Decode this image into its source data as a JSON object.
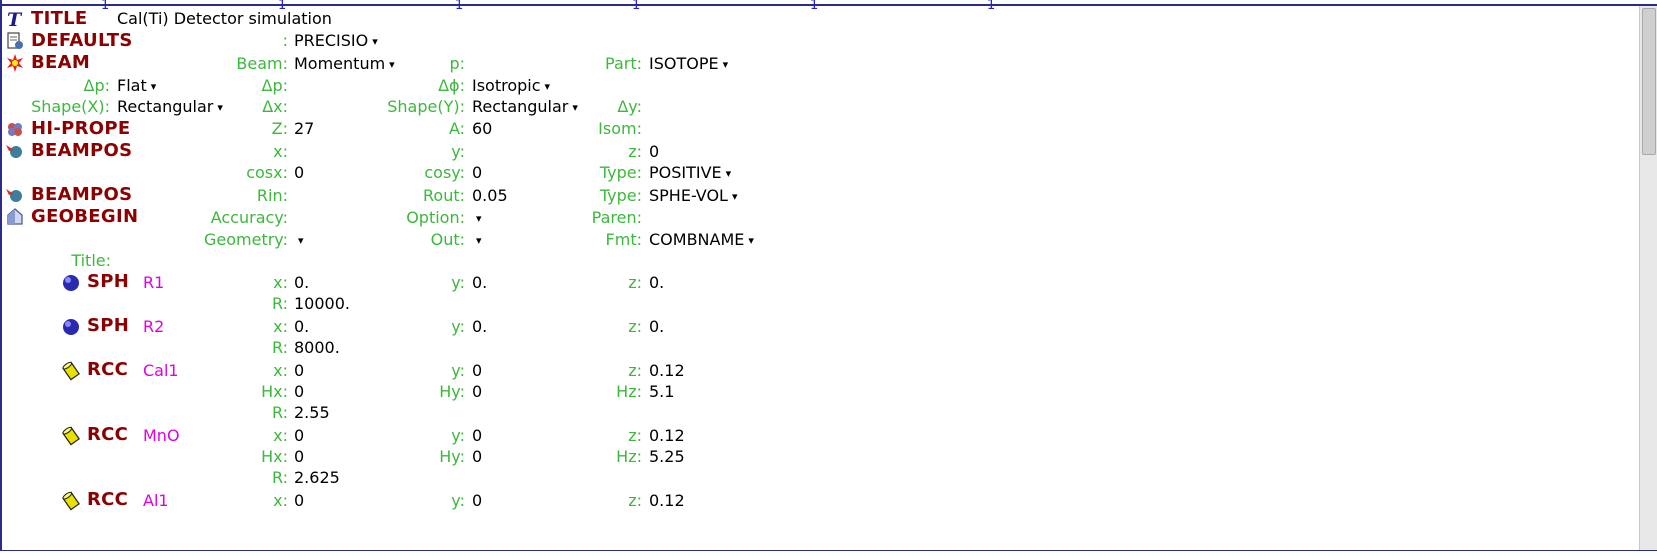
{
  "ruler": {
    "marker": "1"
  },
  "rows": {
    "title": {
      "card": "TITLE",
      "value": "Cal(Ti) Detector simulation"
    },
    "defaults": {
      "card": "DEFAULTS",
      "value": "PRECISIO"
    },
    "beam": {
      "card": "BEAM",
      "beam_label": "Beam:",
      "beam_value": "Momentum",
      "p_label": "p:",
      "part_label": "Part:",
      "part_value": "ISOTOPE",
      "dp_label": "Δp:",
      "dp_value": "Flat",
      "dp2_label": "Δp:",
      "dphi_label": "Δϕ:",
      "dphi_value": "Isotropic",
      "shapex_label": "Shape(X):",
      "shapex_value": "Rectangular",
      "dx_label": "Δx:",
      "shapey_label": "Shape(Y):",
      "shapey_value": "Rectangular",
      "dy_label": "Δy:"
    },
    "hiprope": {
      "card": "HI-PROPE",
      "z_label": "Z:",
      "z_value": "27",
      "a_label": "A:",
      "a_value": "60",
      "isom_label": "Isom:"
    },
    "beampos1": {
      "card": "BEAMPOS",
      "x_label": "x:",
      "y_label": "y:",
      "z_label": "z:",
      "z_value": "0",
      "cosx_label": "cosx:",
      "cosx_value": "0",
      "cosy_label": "cosy:",
      "cosy_value": "0",
      "type_label": "Type:",
      "type_value": "POSITIVE"
    },
    "beampos2": {
      "card": "BEAMPOS",
      "rin_label": "Rin:",
      "rout_label": "Rout:",
      "rout_value": "0.05",
      "type_label": "Type:",
      "type_value": "SPHE-VOL"
    },
    "geobegin": {
      "card": "GEOBEGIN",
      "accuracy_label": "Accuracy:",
      "option_label": "Option:",
      "paren_label": "Paren:",
      "geometry_label": "Geometry:",
      "out_label": "Out:",
      "fmt_label": "Fmt:",
      "fmt_value": "COMBNAME",
      "title_label": "Title:"
    },
    "bodies": [
      {
        "card": "SPH",
        "name": "R1",
        "x": "0.",
        "y": "0.",
        "z": "0.",
        "r": "10000."
      },
      {
        "card": "SPH",
        "name": "R2",
        "x": "0.",
        "y": "0.",
        "z": "0.",
        "r": "8000."
      },
      {
        "card": "RCC",
        "name": "Cal1",
        "x": "0",
        "y": "0",
        "z": "0.12",
        "hx": "0",
        "hy": "0",
        "hz": "5.1",
        "r": "2.55"
      },
      {
        "card": "RCC",
        "name": "MnO",
        "x": "0",
        "y": "0",
        "z": "0.12",
        "hx": "0",
        "hy": "0",
        "hz": "5.25",
        "r": "2.625"
      },
      {
        "card": "RCC",
        "name": "Al1",
        "x": "0",
        "y": "0",
        "z": "0.12"
      }
    ],
    "labels": {
      "x": "x:",
      "y": "y:",
      "z": "z:",
      "r": "R:",
      "hx": "Hx:",
      "hy": "Hy:",
      "hz": "Hz:"
    }
  },
  "dropdown_glyph": "▾",
  "colors": {
    "card": "#8b0000",
    "label": "#3cb83c",
    "name": "#e000e0",
    "border": "#2b2b8c"
  }
}
